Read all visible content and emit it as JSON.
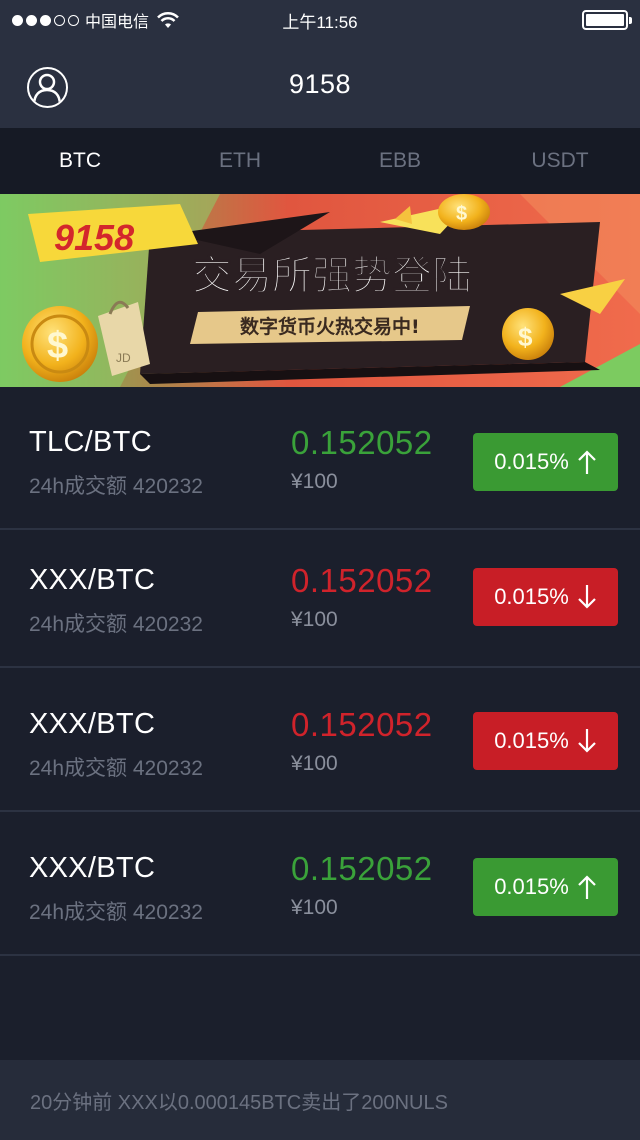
{
  "status_bar": {
    "carrier": "中国电信",
    "time": "上午11:56"
  },
  "header": {
    "title": "9158"
  },
  "tabs": [
    {
      "label": "BTC",
      "active": true
    },
    {
      "label": "ETH",
      "active": false
    },
    {
      "label": "EBB",
      "active": false
    },
    {
      "label": "USDT",
      "active": false
    }
  ],
  "banner": {
    "logo_text": "9158",
    "headline": "交易所强势登陆",
    "subline": "数字货币火热交易中!",
    "bag_text": "JD"
  },
  "markets": [
    {
      "pair": "TLC/BTC",
      "volume": "24h成交额 420232",
      "price": "0.152052",
      "cny": "¥100",
      "change": "0.015%",
      "direction": "up"
    },
    {
      "pair": "XXX/BTC",
      "volume": "24h成交额 420232",
      "price": "0.152052",
      "cny": "¥100",
      "change": "0.015%",
      "direction": "down"
    },
    {
      "pair": "XXX/BTC",
      "volume": "24h成交额 420232",
      "price": "0.152052",
      "cny": "¥100",
      "change": "0.015%",
      "direction": "down"
    },
    {
      "pair": "XXX/BTC",
      "volume": "24h成交额 420232",
      "price": "0.152052",
      "cny": "¥100",
      "change": "0.015%",
      "direction": "up"
    }
  ],
  "ticker": {
    "text": "20分钟前 XXX以0.000145BTC卖出了200NULS"
  },
  "colors": {
    "background": "#1b1f2c",
    "header": "#2a3040",
    "up": "#3aa23a",
    "down": "#d0232b"
  }
}
